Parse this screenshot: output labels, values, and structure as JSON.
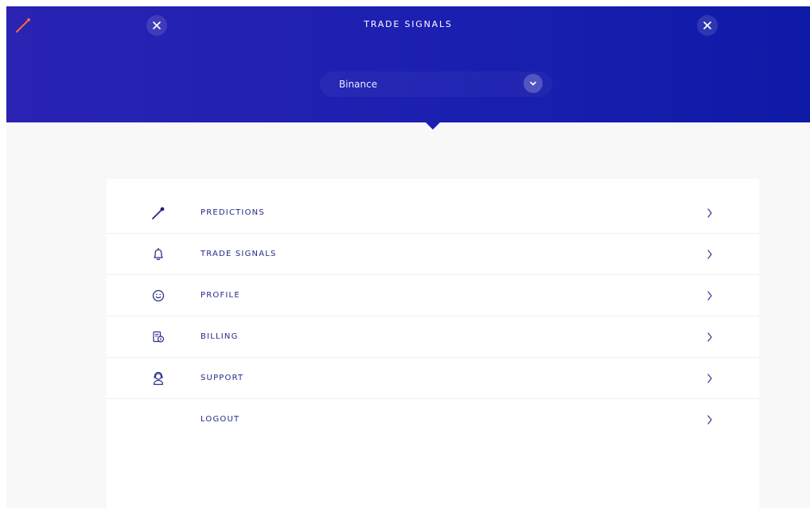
{
  "header": {
    "title": "TRADE SIGNALS",
    "exchange_select": {
      "selected": "Binance"
    }
  },
  "menu": {
    "items": [
      {
        "label": "PREDICTIONS",
        "icon": "prediction-line-icon"
      },
      {
        "label": "TRADE SIGNALS",
        "icon": "bell-icon"
      },
      {
        "label": "PROFILE",
        "icon": "smiley-icon"
      },
      {
        "label": "BILLING",
        "icon": "billing-icon"
      },
      {
        "label": "SUPPORT",
        "icon": "support-agent-icon"
      },
      {
        "label": "LOGOUT",
        "icon": ""
      }
    ]
  },
  "colors": {
    "header_blue": "#1b1fb0",
    "menu_text": "#232a88",
    "accent_orange": "#f26a3d",
    "background": "#f8f8f8"
  }
}
